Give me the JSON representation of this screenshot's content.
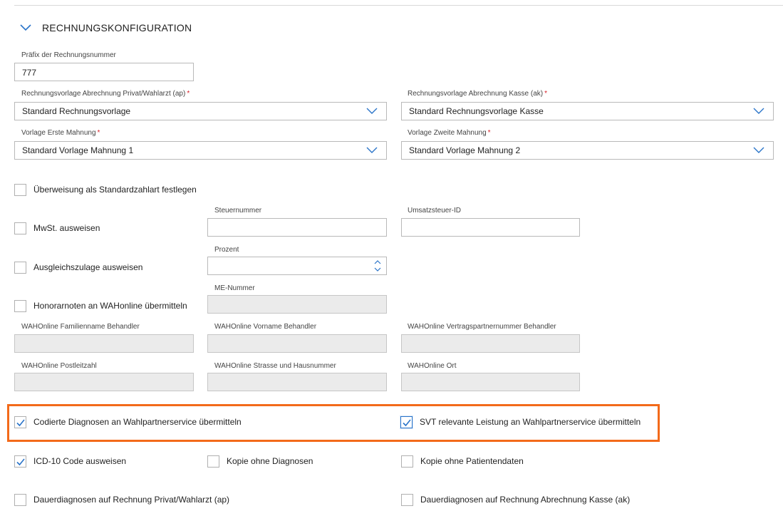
{
  "section": {
    "title": "RECHNUNGSKONFIGURATION"
  },
  "prefix": {
    "label": "Präfix der Rechnungsnummer",
    "value": "777"
  },
  "tpl_private": {
    "label": "Rechnungsvorlage Abrechnung Privat/Wahlarzt (ap)",
    "value": "Standard Rechnungsvorlage"
  },
  "tpl_kasse": {
    "label": "Rechnungsvorlage Abrechnung Kasse (ak)",
    "value": "Standard Rechnungsvorlage Kasse"
  },
  "dun1": {
    "label": "Vorlage Erste Mahnung",
    "value": "Standard Vorlage Mahnung 1"
  },
  "dun2": {
    "label": "Vorlage Zweite Mahnung",
    "value": "Standard Vorlage Mahnung 2"
  },
  "required_mark": "*",
  "transfer": {
    "label": "Überweisung als Standardzahlart festlegen",
    "checked": false
  },
  "vat": {
    "label": "MwSt. ausweisen",
    "checked": false
  },
  "tax_number": {
    "label": "Steuernummer",
    "value": ""
  },
  "vat_id": {
    "label": "Umsatzsteuer-ID",
    "value": ""
  },
  "compensation": {
    "label": "Ausgleichszulage ausweisen",
    "checked": false
  },
  "percent": {
    "label": "Prozent",
    "value": ""
  },
  "wah_submit": {
    "label": "Honorarnoten an WAHonline übermitteln",
    "checked": false
  },
  "me_number": {
    "label": "ME-Nummer",
    "value": ""
  },
  "wah_lastname": {
    "label": "WAHOnline Familienname Behandler",
    "value": ""
  },
  "wah_firstname": {
    "label": "WAHOnline Vorname Behandler",
    "value": ""
  },
  "wah_partner": {
    "label": "WAHOnline Vertragspartnernummer Behandler",
    "value": ""
  },
  "wah_zip": {
    "label": "WAHOnline Postleitzahl",
    "value": ""
  },
  "wah_street": {
    "label": "WAHOnline Strasse und Hausnummer",
    "value": ""
  },
  "wah_city": {
    "label": "WAHOnline Ort",
    "value": ""
  },
  "coded_diag": {
    "label": "Codierte Diagnosen an Wahlpartnerservice übermitteln",
    "checked": true
  },
  "svt": {
    "label": "SVT relevante Leistung an Wahlpartnerservice übermitteln",
    "checked": true
  },
  "icd10": {
    "label": "ICD-10 Code ausweisen",
    "checked": true
  },
  "copy_no_diag": {
    "label": "Kopie ohne Diagnosen",
    "checked": false
  },
  "copy_no_patient": {
    "label": "Kopie ohne Patientendaten",
    "checked": false
  },
  "perm_diag_ap": {
    "label": "Dauerdiagnosen auf Rechnung Privat/Wahlarzt (ap)",
    "checked": false
  },
  "perm_diag_ak": {
    "label": "Dauerdiagnosen auf Rechnung Abrechnung Kasse (ak)",
    "checked": false
  },
  "colors": {
    "accent": "#2a74c9",
    "highlight": "#f36a1a",
    "required": "#d61f26",
    "disabled": "#ebebeb"
  }
}
